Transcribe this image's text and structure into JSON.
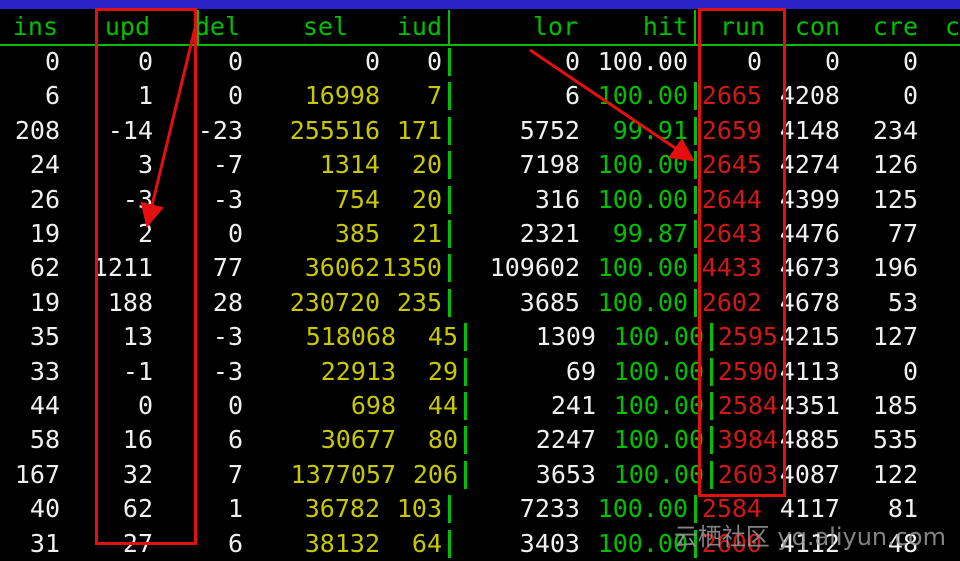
{
  "colors": {
    "background": "#000000",
    "white_value": "#f0f0f0",
    "yellow_value": "#c8c800",
    "green_value": "#00c000",
    "red_value": "#d01818",
    "header": "#00c000",
    "top_bar": "#2b22c8",
    "annotation": "#e41010"
  },
  "columns": [
    {
      "key": "ins",
      "label": "ins"
    },
    {
      "key": "upd",
      "label": "upd"
    },
    {
      "key": "del",
      "label": "del"
    },
    {
      "key": "sel",
      "label": "sel"
    },
    {
      "key": "iud",
      "label": "iud"
    },
    {
      "key": "lor",
      "label": "lor"
    },
    {
      "key": "hit",
      "label": "hit"
    },
    {
      "key": "run",
      "label": "run"
    },
    {
      "key": "con",
      "label": "con"
    },
    {
      "key": "cre",
      "label": "cre"
    },
    {
      "key": "c",
      "label": "c"
    }
  ],
  "rows": [
    {
      "ins": "0",
      "upd": "0",
      "del": "0",
      "sel": "0",
      "iud": "0",
      "lor": "0",
      "hit": "100.00",
      "run": "0",
      "con": "0",
      "cre": "0",
      "sel_color": "white",
      "iud_color": "white",
      "hit_color": "white",
      "run_color": "white"
    },
    {
      "ins": "6",
      "upd": "1",
      "del": "0",
      "sel": "16998",
      "iud": "7",
      "lor": "6",
      "hit": "100.00",
      "run": "2665",
      "con": "4208",
      "cre": "0"
    },
    {
      "ins": "208",
      "upd": "-14",
      "del": "-23",
      "sel": "255516",
      "iud": "171",
      "lor": "5752",
      "hit": "99.91",
      "run": "2659",
      "con": "4148",
      "cre": "234"
    },
    {
      "ins": "24",
      "upd": "3",
      "del": "-7",
      "sel": "1314",
      "iud": "20",
      "lor": "7198",
      "hit": "100.00",
      "run": "2645",
      "con": "4274",
      "cre": "126"
    },
    {
      "ins": "26",
      "upd": "-3",
      "del": "-3",
      "sel": "754",
      "iud": "20",
      "lor": "316",
      "hit": "100.00",
      "run": "2644",
      "con": "4399",
      "cre": "125"
    },
    {
      "ins": "19",
      "upd": "2",
      "del": "0",
      "sel": "385",
      "iud": "21",
      "lor": "2321",
      "hit": "99.87",
      "run": "2643",
      "con": "4476",
      "cre": "77"
    },
    {
      "ins": "62",
      "upd": "1211",
      "del": "77",
      "sel": "36062",
      "iud": "1350",
      "lor": "109602",
      "hit": "100.00",
      "run": "4433",
      "con": "4673",
      "cre": "196"
    },
    {
      "ins": "19",
      "upd": "188",
      "del": "28",
      "sel": "230720",
      "iud": "235",
      "lor": "3685",
      "hit": "100.00",
      "run": "2602",
      "con": "4678",
      "cre": "53"
    },
    {
      "ins": "35",
      "upd": "13",
      "del": "-3",
      "sel": "518068",
      "iud": "45",
      "lor": "1309",
      "hit": "100.00",
      "run": "2595",
      "con": "4215",
      "cre": "127",
      "shifted": true
    },
    {
      "ins": "33",
      "upd": "-1",
      "del": "-3",
      "sel": "22913",
      "iud": "29",
      "lor": "69",
      "hit": "100.00",
      "run": "2590",
      "con": "4113",
      "cre": "0",
      "shifted": true
    },
    {
      "ins": "44",
      "upd": "0",
      "del": "0",
      "sel": "698",
      "iud": "44",
      "lor": "241",
      "hit": "100.00",
      "run": "2584",
      "con": "4351",
      "cre": "185",
      "shifted": true
    },
    {
      "ins": "58",
      "upd": "16",
      "del": "6",
      "sel": "30677",
      "iud": "80",
      "lor": "2247",
      "hit": "100.00",
      "run": "3984",
      "con": "4885",
      "cre": "535",
      "shifted": true
    },
    {
      "ins": "167",
      "upd": "32",
      "del": "7",
      "sel": "1377057",
      "iud": "206",
      "lor": "3653",
      "hit": "100.00",
      "run": "2603",
      "con": "4087",
      "cre": "122",
      "shifted": true
    },
    {
      "ins": "40",
      "upd": "62",
      "del": "1",
      "sel": "36782",
      "iud": "103",
      "lor": "7233",
      "hit": "100.00",
      "run": "2584",
      "con": "4117",
      "cre": "81"
    },
    {
      "ins": "31",
      "upd": "27",
      "del": "6",
      "sel": "38132",
      "iud": "64",
      "lor": "3403",
      "hit": "100.00",
      "run": "2600",
      "con": "4112",
      "cre": "48"
    }
  ],
  "watermark": "云栖社区 yq.aliyun.com"
}
